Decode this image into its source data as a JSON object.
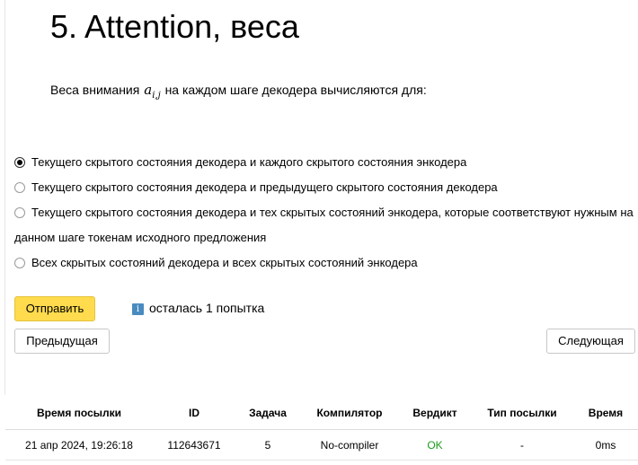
{
  "page": {
    "title": "5. Attention, веса"
  },
  "question": {
    "text_before": "Веса внимания",
    "math_base": "a",
    "math_sub": "i,j",
    "text_after": "на каждом шаге декодера вычисляются для:"
  },
  "options": [
    {
      "label": "Текущего скрытого состояния декодера и каждого скрытого состояния энкодера",
      "checked": true
    },
    {
      "label": "Текущего скрытого состояния декодера и предыдущего скрытого состояния декодера",
      "checked": false
    },
    {
      "label": "Текущего скрытого состояния декодера и тех скрытых состояний энкодера, которые соответствуют нужным на данном шаге токенам исходного предложения",
      "checked": false
    },
    {
      "label": "Всех скрытых состояний декодера и всех скрытых состояний энкодера",
      "checked": false
    }
  ],
  "actions": {
    "submit_label": "Отправить",
    "attempts_text": "осталась 1 попытка",
    "info_glyph": "i",
    "prev_label": "Предыдущая",
    "next_label": "Следующая"
  },
  "submissions": {
    "headers": {
      "time": "Время посылки",
      "id": "ID",
      "task": "Задача",
      "compiler": "Компилятор",
      "verdict": "Вердикт",
      "type": "Тип посылки",
      "duration": "Время"
    },
    "rows": [
      {
        "time": "21 апр 2024, 19:26:18",
        "id": "112643671",
        "task": "5",
        "compiler": "No-compiler",
        "verdict": "OK",
        "type": "-",
        "duration": "0ms"
      }
    ]
  },
  "colors": {
    "submit_button": "#ffdb4d",
    "verdict_ok": "#1d9c1d",
    "info_icon": "#4a8bbf"
  }
}
